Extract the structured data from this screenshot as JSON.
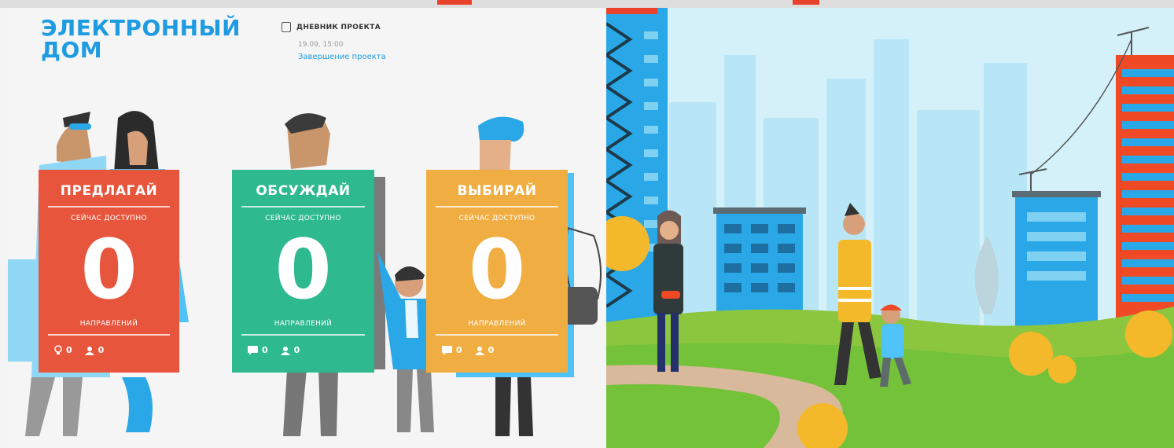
{
  "logo": {
    "line1": "ЭЛЕКТРОННЫЙ",
    "line2": "ДОМ"
  },
  "diary": {
    "title": "ДНЕВНИК ПРОЕКТА",
    "date": "19.09, 15:00",
    "link": "Завершение проекта"
  },
  "cards": [
    {
      "title": "ПРЕДЛАГАЙ",
      "available": "СЕЙЧАС ДОСТУПНО",
      "count": "0",
      "unit": "НАПРАВЛЕНИЙ",
      "stat1": "0",
      "stat2": "0",
      "color": "#e7553c",
      "icon1": "lightbulb-icon",
      "icon2": "user-icon"
    },
    {
      "title": "ОБСУЖДАЙ",
      "available": "СЕЙЧАС ДОСТУПНО",
      "count": "0",
      "unit": "НАПРАВЛЕНИЙ",
      "stat1": "0",
      "stat2": "0",
      "color": "#2fb98e",
      "icon1": "comment-icon",
      "icon2": "user-icon"
    },
    {
      "title": "ВЫБИРАЙ",
      "available": "СЕЙЧАС ДОСТУПНО",
      "count": "0",
      "unit": "НАПРАВЛЕНИЙ",
      "stat1": "0",
      "stat2": "0",
      "color": "#f0ae42",
      "icon1": "comment-icon",
      "icon2": "user-icon"
    }
  ],
  "colors": {
    "brand_blue": "#1f9ce1",
    "red": "#e7553c",
    "green": "#2fb98e",
    "orange": "#f0ae42",
    "sky": "#d4f1fa",
    "grass": "#73c23a"
  }
}
